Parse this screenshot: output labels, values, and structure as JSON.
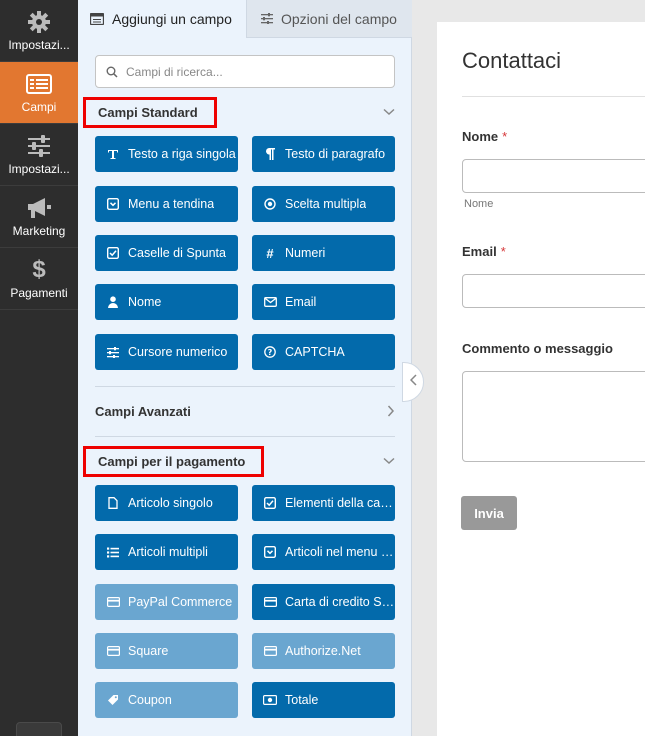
{
  "sidebar": {
    "items": [
      {
        "label": "Impostazi...",
        "icon": "gear-icon"
      },
      {
        "label": "Campi",
        "icon": "fields-list-icon",
        "active": true
      },
      {
        "label": "Impostazi...",
        "icon": "sliders-icon"
      },
      {
        "label": "Marketing",
        "icon": "megaphone-icon"
      },
      {
        "label": "Pagamenti",
        "icon": "dollar-icon"
      }
    ]
  },
  "panel": {
    "tabs": [
      {
        "label": "Aggiungi un campo",
        "icon": "table-icon"
      },
      {
        "label": "Opzioni del campo",
        "icon": "sliders-small-icon"
      }
    ],
    "search": {
      "placeholder": "Campi di ricerca..."
    },
    "standard": {
      "title": "Campi Standard",
      "fields": [
        {
          "label": "Testo a riga singola",
          "icon": "text-icon"
        },
        {
          "label": "Testo di paragrafo",
          "icon": "paragraph-icon"
        },
        {
          "label": "Menu a tendina",
          "icon": "dropdown-icon"
        },
        {
          "label": "Scelta multipla",
          "icon": "radio-icon"
        },
        {
          "label": "Caselle di Spunta",
          "icon": "checkbox-icon"
        },
        {
          "label": "Numeri",
          "icon": "hash-icon"
        },
        {
          "label": "Nome",
          "icon": "user-icon"
        },
        {
          "label": "Email",
          "icon": "envelope-icon"
        },
        {
          "label": "Cursore numerico",
          "icon": "slider-icon"
        },
        {
          "label": "CAPTCHA",
          "icon": "question-circle-icon"
        }
      ]
    },
    "advanced": {
      "title": "Campi Avanzati"
    },
    "payment": {
      "title": "Campi per il pagamento",
      "fields": [
        {
          "label": "Articolo singolo",
          "icon": "file-icon"
        },
        {
          "label": "Elementi della case...",
          "icon": "checkbox-icon"
        },
        {
          "label": "Articoli multipli",
          "icon": "list-icon"
        },
        {
          "label": "Articoli nel menu a ...",
          "icon": "dropdown-icon"
        },
        {
          "label": "PayPal Commerce",
          "icon": "credit-card-icon"
        },
        {
          "label": "Carta di credito Str...",
          "icon": "credit-card-icon"
        },
        {
          "label": "Square",
          "icon": "credit-card-icon"
        },
        {
          "label": "Authorize.Net",
          "icon": "credit-card-icon"
        },
        {
          "label": "Coupon",
          "icon": "tag-icon"
        },
        {
          "label": "Totale",
          "icon": "money-icon"
        }
      ]
    }
  },
  "form": {
    "title": "Contattaci",
    "name_label": "Nome",
    "name_required": "*",
    "name_sublabel": "Nome",
    "email_label": "Email",
    "email_required": "*",
    "message_label": "Commento o messaggio",
    "submit_label": "Invia"
  },
  "colors": {
    "sidebar_bg": "#2d2d2d",
    "active_orange": "#e27730",
    "field_button_blue": "#036aab",
    "field_button_light": "#6aa6d0",
    "panel_bg": "#ebf3fc",
    "highlight_red": "#ee0000"
  }
}
